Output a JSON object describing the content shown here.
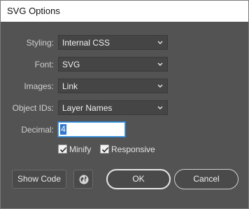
{
  "window": {
    "title": "SVG Options"
  },
  "fields": {
    "styling": {
      "label": "Styling:",
      "value": "Internal CSS"
    },
    "font": {
      "label": "Font:",
      "value": "SVG"
    },
    "images": {
      "label": "Images:",
      "value": "Link"
    },
    "object_ids": {
      "label": "Object IDs:",
      "value": "Layer Names"
    },
    "decimal": {
      "label": "Decimal:",
      "value": "4"
    }
  },
  "checkboxes": {
    "minify": {
      "label": "Minify",
      "checked": true
    },
    "responsive": {
      "label": "Responsive",
      "checked": true
    }
  },
  "buttons": {
    "show_code": "Show Code",
    "globe_icon": "globe-icon",
    "ok": "OK",
    "cancel": "Cancel"
  },
  "colors": {
    "dialog_bg": "#535353",
    "control_bg": "#454545",
    "input_focus": "#4aa0e6",
    "selection": "#2f77d6"
  }
}
